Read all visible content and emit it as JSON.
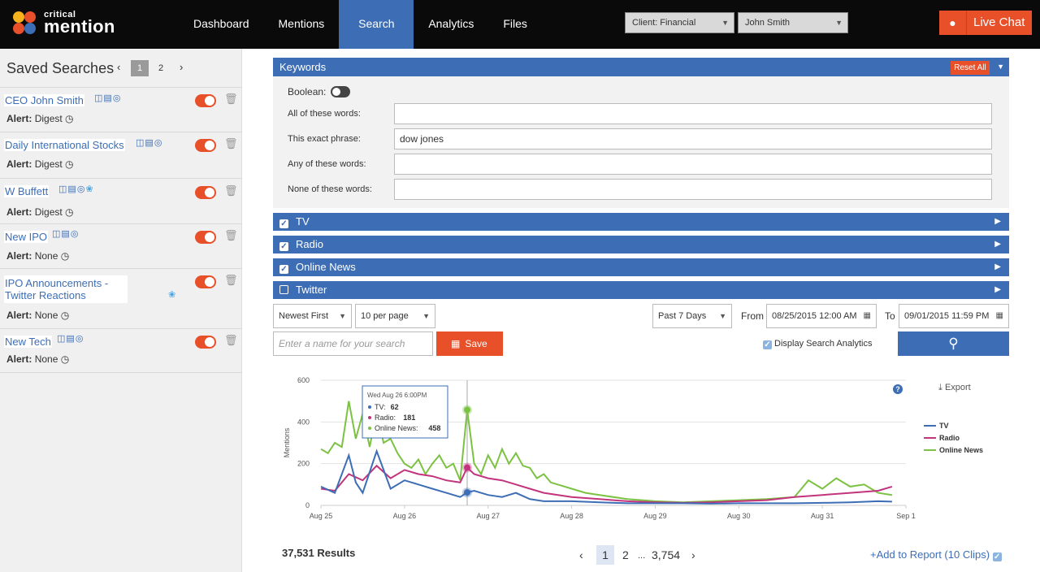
{
  "brand": {
    "top": "critical",
    "main": "mention"
  },
  "nav": [
    {
      "label": "Dashboard",
      "active": false
    },
    {
      "label": "Mentions",
      "active": false
    },
    {
      "label": "Search",
      "active": true
    },
    {
      "label": "Analytics",
      "active": false
    },
    {
      "label": "Files",
      "active": false
    }
  ],
  "header": {
    "client_select": "Client: Financial",
    "user_select": "John Smith",
    "live_chat": "Live Chat"
  },
  "sidebar": {
    "title": "Saved Searches",
    "pages": [
      "1",
      "2"
    ],
    "current_page": "1",
    "alert_label": "Alert:",
    "searches": [
      {
        "name": "CEO John Smith",
        "alert": "Digest",
        "icons": [
          "tv-icon",
          "radio-icon",
          "globe-icon"
        ]
      },
      {
        "name": "Daily International Stocks",
        "alert": "Digest",
        "icons": [
          "tv-icon",
          "radio-icon",
          "globe-icon"
        ]
      },
      {
        "name": "W Buffett",
        "alert": "Digest",
        "icons": [
          "tv-icon",
          "radio-icon",
          "globe-icon",
          "twitter-icon"
        ]
      },
      {
        "name": "New IPO",
        "alert": "None",
        "icons": [
          "tv-icon",
          "radio-icon",
          "globe-icon"
        ]
      },
      {
        "name": "IPO Announcements - Twitter Reactions",
        "alert": "None",
        "icons": [
          "twitter-icon"
        ]
      },
      {
        "name": "New Tech",
        "alert": "None",
        "icons": [
          "tv-icon",
          "radio-icon",
          "globe-icon"
        ]
      }
    ]
  },
  "keywords": {
    "title": "Keywords",
    "reset_all": "Reset All",
    "boolean_label": "Boolean:",
    "fields": [
      {
        "label": "All of these words:",
        "value": ""
      },
      {
        "label": "This exact phrase:",
        "value": "dow jones"
      },
      {
        "label": "Any of these words:",
        "value": ""
      },
      {
        "label": "None of these words:",
        "value": ""
      }
    ]
  },
  "sources": [
    {
      "label": "TV",
      "checked": true
    },
    {
      "label": "Radio",
      "checked": true
    },
    {
      "label": "Online News",
      "checked": true
    },
    {
      "label": "Twitter",
      "checked": false
    }
  ],
  "controls": {
    "sort": "Newest First",
    "per_page": "10 per page",
    "range": "Past 7 Days",
    "from_label": "From",
    "from_value": "08/25/2015 12:00 AM",
    "to_label": "To",
    "to_value": "09/01/2015 11:59 PM",
    "name_placeholder": "Enter a name for your search",
    "save": "Save",
    "display_analytics": "Display Search Analytics",
    "export": "Export"
  },
  "chart_data": {
    "type": "line",
    "ylabel": "Mentions",
    "ylim": [
      0,
      600
    ],
    "yticks": [
      0,
      200,
      400,
      600
    ],
    "xticks": [
      "Aug 25",
      "Aug 26",
      "Aug 27",
      "Aug 28",
      "Aug 29",
      "Aug 30",
      "Aug 31",
      "Sep 1"
    ],
    "x_hours_range": [
      0,
      168
    ],
    "series": [
      {
        "name": "TV",
        "color": "#3d6eb5",
        "points": [
          [
            0,
            90
          ],
          [
            4,
            60
          ],
          [
            8,
            240
          ],
          [
            10,
            110
          ],
          [
            12,
            60
          ],
          [
            16,
            260
          ],
          [
            20,
            80
          ],
          [
            24,
            120
          ],
          [
            28,
            100
          ],
          [
            32,
            80
          ],
          [
            36,
            60
          ],
          [
            40,
            40
          ],
          [
            42,
            62
          ],
          [
            44,
            70
          ],
          [
            48,
            50
          ],
          [
            52,
            40
          ],
          [
            56,
            60
          ],
          [
            60,
            30
          ],
          [
            64,
            20
          ],
          [
            72,
            20
          ],
          [
            80,
            15
          ],
          [
            88,
            10
          ],
          [
            96,
            10
          ],
          [
            104,
            10
          ],
          [
            112,
            8
          ],
          [
            120,
            10
          ],
          [
            128,
            10
          ],
          [
            136,
            10
          ],
          [
            144,
            12
          ],
          [
            152,
            15
          ],
          [
            160,
            20
          ],
          [
            164,
            18
          ]
        ]
      },
      {
        "name": "Radio",
        "color": "#c2347d",
        "points": [
          [
            0,
            80
          ],
          [
            4,
            70
          ],
          [
            8,
            150
          ],
          [
            12,
            120
          ],
          [
            16,
            190
          ],
          [
            20,
            130
          ],
          [
            24,
            170
          ],
          [
            28,
            150
          ],
          [
            32,
            140
          ],
          [
            36,
            120
          ],
          [
            40,
            110
          ],
          [
            42,
            181
          ],
          [
            44,
            150
          ],
          [
            48,
            130
          ],
          [
            52,
            120
          ],
          [
            56,
            100
          ],
          [
            60,
            80
          ],
          [
            64,
            60
          ],
          [
            72,
            40
          ],
          [
            80,
            30
          ],
          [
            88,
            20
          ],
          [
            96,
            15
          ],
          [
            104,
            12
          ],
          [
            112,
            15
          ],
          [
            120,
            20
          ],
          [
            128,
            25
          ],
          [
            136,
            40
          ],
          [
            144,
            50
          ],
          [
            152,
            60
          ],
          [
            160,
            70
          ],
          [
            164,
            90
          ]
        ]
      },
      {
        "name": "Online News",
        "color": "#7cc242",
        "points": [
          [
            0,
            270
          ],
          [
            2,
            250
          ],
          [
            4,
            300
          ],
          [
            6,
            280
          ],
          [
            8,
            500
          ],
          [
            10,
            320
          ],
          [
            12,
            440
          ],
          [
            14,
            280
          ],
          [
            16,
            450
          ],
          [
            18,
            300
          ],
          [
            20,
            320
          ],
          [
            22,
            250
          ],
          [
            24,
            200
          ],
          [
            26,
            180
          ],
          [
            28,
            220
          ],
          [
            30,
            150
          ],
          [
            32,
            200
          ],
          [
            34,
            240
          ],
          [
            36,
            180
          ],
          [
            38,
            200
          ],
          [
            40,
            120
          ],
          [
            42,
            458
          ],
          [
            44,
            200
          ],
          [
            46,
            150
          ],
          [
            48,
            240
          ],
          [
            50,
            180
          ],
          [
            52,
            270
          ],
          [
            54,
            200
          ],
          [
            56,
            250
          ],
          [
            58,
            190
          ],
          [
            60,
            180
          ],
          [
            62,
            130
          ],
          [
            64,
            150
          ],
          [
            66,
            110
          ],
          [
            68,
            100
          ],
          [
            72,
            80
          ],
          [
            76,
            60
          ],
          [
            80,
            50
          ],
          [
            88,
            30
          ],
          [
            96,
            20
          ],
          [
            104,
            15
          ],
          [
            112,
            20
          ],
          [
            120,
            25
          ],
          [
            128,
            30
          ],
          [
            136,
            40
          ],
          [
            140,
            120
          ],
          [
            144,
            80
          ],
          [
            148,
            130
          ],
          [
            152,
            90
          ],
          [
            156,
            100
          ],
          [
            160,
            60
          ],
          [
            164,
            50
          ]
        ]
      }
    ],
    "tooltip": {
      "title": "Wed Aug 26 6:00PM",
      "x_hour": 42,
      "lines": [
        {
          "label": "TV:",
          "value": "62"
        },
        {
          "label": "Radio:",
          "value": "181"
        },
        {
          "label": "Online News:",
          "value": "458"
        }
      ]
    },
    "legend_position": "right"
  },
  "footer": {
    "results": "37,531 Results",
    "pages": [
      "1",
      "2",
      "...",
      "3,754"
    ],
    "add_to_report": "Add to Report (10 Clips)"
  }
}
